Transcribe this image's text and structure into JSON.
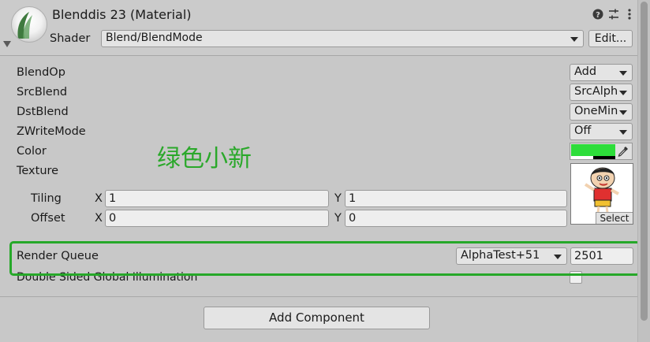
{
  "header": {
    "title": "Blenddis 23 (Material)",
    "shader_label": "Shader",
    "shader_value": "Blend/BlendMode",
    "edit_label": "Edit...",
    "icons": [
      "help-icon",
      "settings-sliders-icon",
      "more-vertical-icon"
    ]
  },
  "properties": [
    {
      "label": "BlendOp",
      "value": "Add"
    },
    {
      "label": "SrcBlend",
      "value": "SrcAlph"
    },
    {
      "label": "DstBlend",
      "value": "OneMin"
    },
    {
      "label": "ZWriteMode",
      "value": "Off"
    }
  ],
  "color": {
    "label": "Color",
    "swatch": "#2ddd3a"
  },
  "texture": {
    "label": "Texture",
    "select_label": "Select",
    "tiling": {
      "label": "Tiling",
      "x_axis": "X",
      "x": "1",
      "y_axis": "Y",
      "y": "1"
    },
    "offset": {
      "label": "Offset",
      "x_axis": "X",
      "x": "0",
      "y_axis": "Y",
      "y": "0"
    }
  },
  "watermark": "绿色小新",
  "render_queue": {
    "label": "Render Queue",
    "mode": "AlphaTest+51",
    "value": "2501"
  },
  "gi": {
    "label": "Double Sided Global Illumination",
    "checked": false
  },
  "add_component_label": "Add Component",
  "accent_colors": {
    "highlight": "#26a829",
    "swatch": "#2ddd3a"
  }
}
